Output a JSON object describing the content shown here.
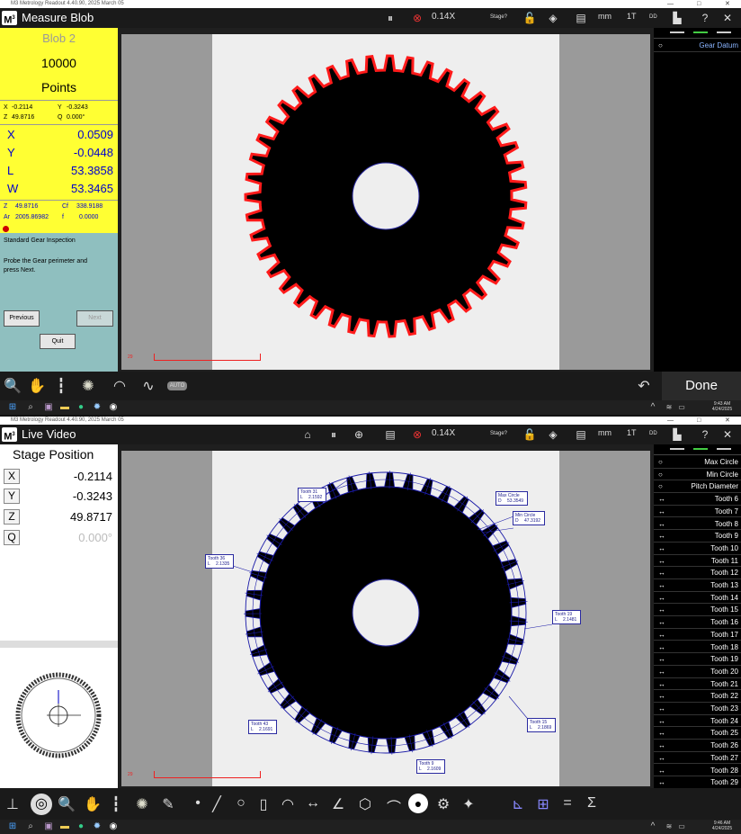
{
  "top": {
    "window_title": "M3 Metrology Readout  4.40.90, 2025 March 05",
    "app_title": "Measure Blob",
    "zoom": "0.14X",
    "stage": "Stage?",
    "units": "mm",
    "tool_1t": "1T",
    "tool_dd": "DD",
    "blob": {
      "name": "Blob 2",
      "count": "10000",
      "unit": "Points"
    },
    "small": {
      "x_label": "X",
      "x": "-0.2114",
      "y_label": "Y",
      "y": "-0.3243",
      "z_label": "Z",
      "z": "49.8716",
      "q_label": "Q",
      "q": "0.000°"
    },
    "results": [
      {
        "label": "X",
        "value": "0.0509"
      },
      {
        "label": "Y",
        "value": "-0.0448"
      },
      {
        "label": "L",
        "value": "53.3858"
      },
      {
        "label": "W",
        "value": "53.3465"
      }
    ],
    "extra": {
      "z_label": "Z",
      "z": "49.8716",
      "cf_label": "Cf",
      "cf": "338.9188",
      "ar_label": "Ar",
      "ar": "2005.86982",
      "f_label": "f",
      "f": "0.0000"
    },
    "instructions_title": "Standard Gear Inspection",
    "instructions_body": "Probe the Gear perimeter and press Next.",
    "previous": "Previous",
    "next": "Next",
    "quit": "Quit",
    "scale_number": "29",
    "right_list": [
      {
        "label": "Gear Datum"
      }
    ],
    "done": "Done",
    "auto_label": "AUTO",
    "clock_time": "9:43 AM",
    "clock_date": "4/24/2025"
  },
  "bottom": {
    "window_title": "M3 Metrology Readout  4.40.90, 2025 March 05",
    "app_title": "Live Video",
    "zoom": "0.14X",
    "stage": "Stage?",
    "units": "mm",
    "tool_1t": "1T",
    "tool_dd": "DD",
    "position_title": "Stage Position",
    "coords": [
      {
        "label": "X",
        "value": "-0.2114"
      },
      {
        "label": "Y",
        "value": "-0.3243"
      },
      {
        "label": "Z",
        "value": "49.8717"
      },
      {
        "label": "Q",
        "value": "0.000°"
      }
    ],
    "scale_number": "29",
    "annotations": [
      {
        "name": "Tooth 31",
        "val_label": "L",
        "value": "2.1592"
      },
      {
        "name": "Max Circle",
        "val_label": "D",
        "value": "53.3549"
      },
      {
        "name": "Min Circle",
        "val_label": "D",
        "value": "47.3192"
      },
      {
        "name": "Tooth 36",
        "val_label": "L",
        "value": "2.1335"
      },
      {
        "name": "Tooth 19",
        "val_label": "L",
        "value": "2.1481"
      },
      {
        "name": "Tooth 15",
        "val_label": "L",
        "value": "2.1869"
      },
      {
        "name": "Tooth 43",
        "val_label": "L",
        "value": "2.1691"
      },
      {
        "name": "Tooth 9",
        "val_label": "L",
        "value": "2.1609"
      }
    ],
    "right_list": [
      {
        "label": "Max Circle",
        "icon": "circle"
      },
      {
        "label": "Min Circle",
        "icon": "circle"
      },
      {
        "label": "Pitch Diameter",
        "icon": "circle"
      },
      {
        "label": "Tooth 6",
        "icon": "distance"
      },
      {
        "label": "Tooth 7",
        "icon": "distance"
      },
      {
        "label": "Tooth 8",
        "icon": "distance"
      },
      {
        "label": "Tooth 9",
        "icon": "distance"
      },
      {
        "label": "Tooth 10",
        "icon": "distance"
      },
      {
        "label": "Tooth 11",
        "icon": "distance"
      },
      {
        "label": "Tooth 12",
        "icon": "distance"
      },
      {
        "label": "Tooth 13",
        "icon": "distance"
      },
      {
        "label": "Tooth 14",
        "icon": "distance"
      },
      {
        "label": "Tooth 15",
        "icon": "distance"
      },
      {
        "label": "Tooth 16",
        "icon": "distance"
      },
      {
        "label": "Tooth 17",
        "icon": "distance"
      },
      {
        "label": "Tooth 18",
        "icon": "distance"
      },
      {
        "label": "Tooth 19",
        "icon": "distance"
      },
      {
        "label": "Tooth 20",
        "icon": "distance"
      },
      {
        "label": "Tooth 21",
        "icon": "distance"
      },
      {
        "label": "Tooth 22",
        "icon": "distance"
      },
      {
        "label": "Tooth 23",
        "icon": "distance"
      },
      {
        "label": "Tooth 24",
        "icon": "distance"
      },
      {
        "label": "Tooth 25",
        "icon": "distance"
      },
      {
        "label": "Tooth 26",
        "icon": "distance"
      },
      {
        "label": "Tooth 27",
        "icon": "distance"
      },
      {
        "label": "Tooth 28",
        "icon": "distance"
      },
      {
        "label": "Tooth 29",
        "icon": "distance"
      }
    ],
    "clock_time": "9:46 AM",
    "clock_date": "4/24/2025"
  },
  "colors": {
    "yellow": "#ffff33",
    "teal": "#8fbfbf",
    "blue_text": "#0000cc",
    "edge_red": "#ff1a1a",
    "overlay_blue": "#1a1aa8"
  },
  "icons": [
    "pause-icon",
    "target-icon",
    "lock-icon",
    "rotate-icon",
    "grid-icon",
    "chart-icon",
    "help-icon",
    "close-icon",
    "home-icon",
    "crosshair-icon",
    "table-icon",
    "magnify-icon",
    "hand-icon",
    "probe-icon",
    "light-icon",
    "wave-icon",
    "undo-icon",
    "windows-icon",
    "search-icon",
    "wifi-icon",
    "battery-icon"
  ]
}
